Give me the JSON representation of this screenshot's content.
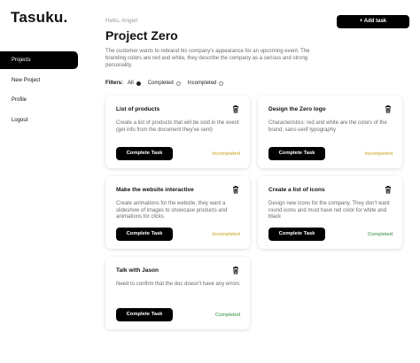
{
  "app": {
    "logo": "Tasuku."
  },
  "sidebar": {
    "items": [
      {
        "label": "Projects",
        "active": true
      },
      {
        "label": "New Project",
        "active": false
      },
      {
        "label": "Profile",
        "active": false
      },
      {
        "label": "Logout",
        "active": false
      }
    ]
  },
  "header": {
    "greeting": "Hello, Angie!",
    "title": "Project Zero",
    "description": "The customer wants to rebrand his company's appearance for an upcoming event. The branding colors are red and white, they describe the company as a serious and strong personality.",
    "add_task_label": "+ Add task"
  },
  "filters": {
    "label": "Filters:",
    "options": [
      {
        "label": "All",
        "selected": true
      },
      {
        "label": "Completed",
        "selected": false
      },
      {
        "label": "Incompleted",
        "selected": false
      }
    ]
  },
  "tasks": [
    {
      "title": "List of products",
      "description": "Create a list of products that will be sold in the event (get info from the document they've sent)",
      "button": "Complete Task",
      "status": "Incompleted"
    },
    {
      "title": "Design the Zero logo",
      "description": "Characteristics: red and white are the colors of the brand, sans-serif typography",
      "button": "Complete Task",
      "status": "Incompleted"
    },
    {
      "title": "Make the website interactive",
      "description": "Create animations for the website, they want a slideshow of images to showcase products and animations for clicks",
      "button": "Complete Task",
      "status": "Incompleted"
    },
    {
      "title": "Create a list of icons",
      "description": "Design new icons for the company. They don't want round icons and must have red color for white and black",
      "button": "Complete Task",
      "status": "Completed"
    },
    {
      "title": "Talk with Jason",
      "description": "Need to confirm that the doc doesn't have any errors",
      "button": "Complete Task",
      "status": "Completed"
    }
  ],
  "icons": {
    "task_delete": "trash-icon",
    "filter_selected": "radio-filled",
    "filter_unselected": "radio-empty"
  },
  "colors": {
    "primary": "#000000",
    "incompleted": "#c9a21a",
    "completed": "#2f8a3a"
  }
}
